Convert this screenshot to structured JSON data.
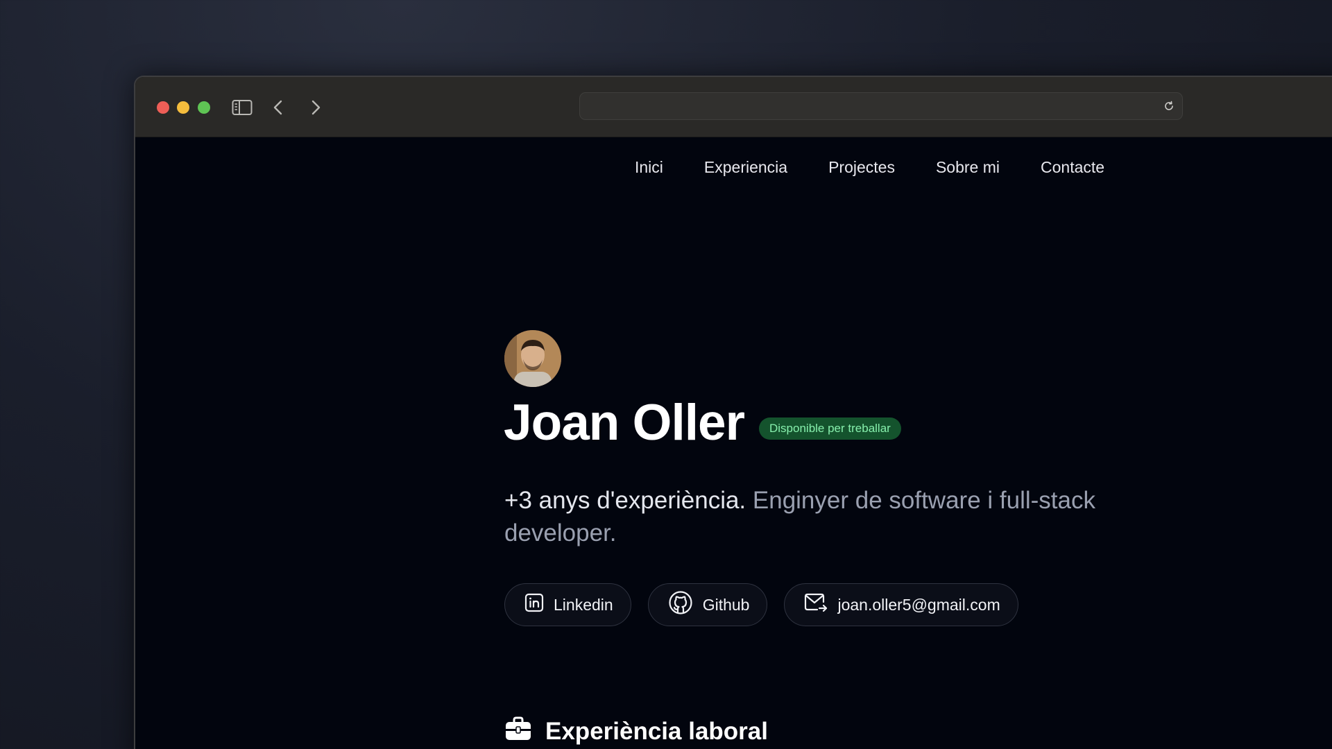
{
  "browser": {
    "url": ""
  },
  "nav": {
    "items": [
      "Inici",
      "Experiencia",
      "Projectes",
      "Sobre mi",
      "Contacte"
    ]
  },
  "hero": {
    "name": "Joan Oller",
    "badge": "Disponible per treballar",
    "tagline_strong": "+3 anys d'experiència.",
    "tagline_rest": " Enginyer de software i full-stack developer.",
    "links": [
      {
        "label": "Linkedin",
        "icon": "linkedin-icon"
      },
      {
        "label": "Github",
        "icon": "github-icon"
      },
      {
        "label": "joan.oller5@gmail.com",
        "icon": "mail-icon"
      }
    ]
  },
  "sections": {
    "experience_title": "Experiència laboral"
  },
  "colors": {
    "badge_bg": "#14532d",
    "badge_text": "#86efac",
    "page_bg": "#02050e"
  }
}
